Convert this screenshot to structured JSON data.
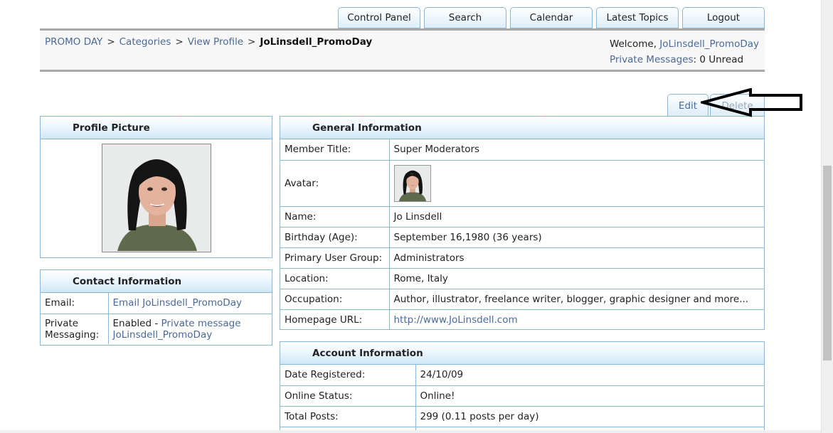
{
  "nav": {
    "control_panel": "Control Panel",
    "search": "Search",
    "calendar": "Calendar",
    "latest_topics": "Latest Topics",
    "logout": "Logout"
  },
  "breadcrumb": {
    "items": [
      "PROMO DAY",
      "Categories",
      "View Profile"
    ],
    "separator": ">",
    "current": "JoLinsdell_PromoDay"
  },
  "welcome": {
    "prefix": "Welcome, ",
    "username": "JoLinsdell_PromoDay",
    "pm_label": "Private Messages",
    "pm_status": ": 0 Unread"
  },
  "tabs": {
    "edit": "Edit",
    "delete": "Delete"
  },
  "profile_picture": {
    "title": "Profile Picture"
  },
  "contact": {
    "title": "Contact Information",
    "email_label": "Email:",
    "email_link": "Email JoLinsdell_PromoDay",
    "pm_label": "Private Messaging:",
    "pm_enabled": "Enabled - ",
    "pm_link": "Private message JoLinsdell_PromoDay"
  },
  "general": {
    "title": "General Information",
    "rows": [
      {
        "label": "Member Title:",
        "value": "Super Moderators"
      },
      {
        "label": "Avatar:",
        "value": ""
      },
      {
        "label": "Name:",
        "value": "Jo Linsdell"
      },
      {
        "label": "Birthday (Age):",
        "value": "September 16,1980 (36 years)"
      },
      {
        "label": "Primary User Group:",
        "value": "Administrators"
      },
      {
        "label": "Location:",
        "value": "Rome, Italy"
      },
      {
        "label": "Occupation:",
        "value": "Author, illustrator, freelance writer, blogger, graphic designer and more..."
      },
      {
        "label": "Homepage URL:",
        "value": "http://www.JoLinsdell.com"
      }
    ]
  },
  "account": {
    "title": "Account Information",
    "rows": [
      {
        "label": "Date Registered:",
        "value": "24/10/09"
      },
      {
        "label": "Online Status:",
        "value": "Online!"
      },
      {
        "label": "Total Posts:",
        "value": "299 (0.11 posts per day)"
      }
    ]
  },
  "colors": {
    "accent_border": "#86b8dc",
    "link": "#4a6a9c",
    "header_gradient_end": "#cfe7f8"
  },
  "icons": [
    "arrow-pointer-icon"
  ]
}
